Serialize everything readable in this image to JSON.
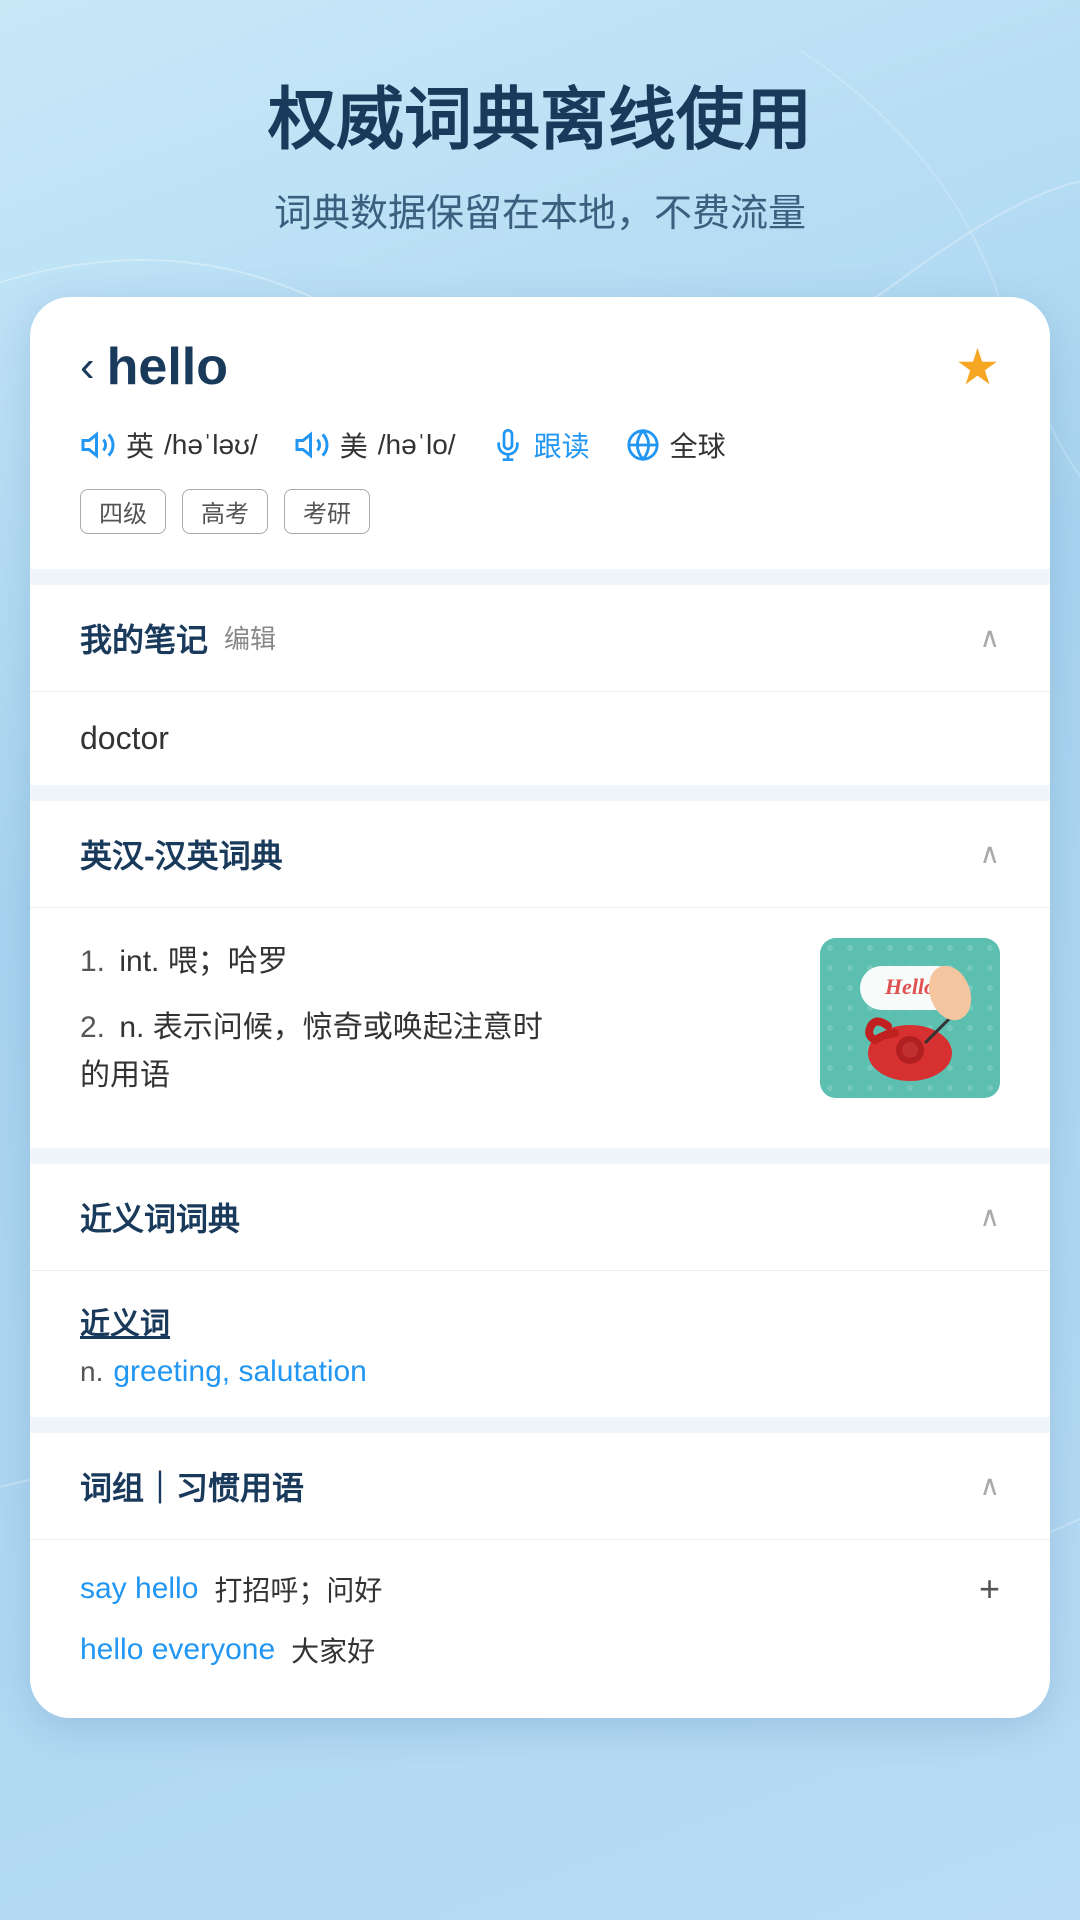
{
  "background": {
    "gradient_start": "#c8e8f8",
    "gradient_end": "#a8d4f0"
  },
  "top": {
    "main_title": "权威词典离线使用",
    "sub_title": "词典数据保留在本地，不费流量"
  },
  "word_header": {
    "back_label": "‹",
    "word": "hello",
    "star_filled": true,
    "pronunciations": [
      {
        "region": "英",
        "phonetic": "/həˈləʊ/"
      },
      {
        "region": "美",
        "phonetic": "/həˈlo/"
      }
    ],
    "follow_read_label": "跟读",
    "global_label": "全球",
    "tags": [
      "四级",
      "高考",
      "考研"
    ]
  },
  "sections": {
    "notes": {
      "title": "我的笔记",
      "edit_label": "编辑",
      "content": "doctor",
      "collapsed": false
    },
    "dictionary": {
      "title": "英汉-汉英词典",
      "collapsed": false,
      "definitions": [
        {
          "num": "1.",
          "pos": "int.",
          "text": "喂；哈罗"
        },
        {
          "num": "2.",
          "pos": "n.",
          "text": "表示问候，惊奇或唤起注意时的用语"
        }
      ]
    },
    "synonyms": {
      "title": "近义词词典",
      "collapsed": false,
      "synonym_label": "近义词",
      "pos": "n.",
      "words": "greeting, salutation"
    },
    "phrases": {
      "title": "词组｜习惯用语",
      "collapsed": false,
      "items": [
        {
          "en": "say hello",
          "cn": "打招呼；问好"
        },
        {
          "en": "hello everyone",
          "cn": "大家好"
        }
      ]
    }
  }
}
